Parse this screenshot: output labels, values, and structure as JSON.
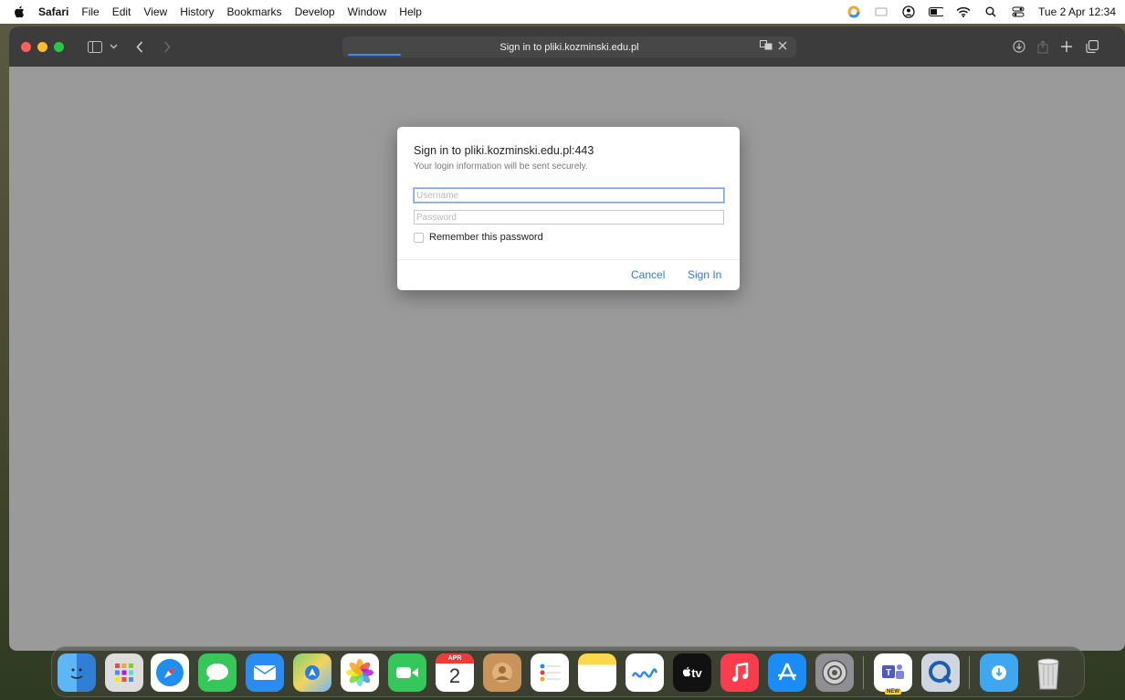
{
  "menubar": {
    "app_name": "Safari",
    "items": [
      "File",
      "Edit",
      "View",
      "History",
      "Bookmarks",
      "Develop",
      "Window",
      "Help"
    ],
    "clock": "Tue 2 Apr  12:34"
  },
  "browser": {
    "address_text": "Sign in to pliki.kozminski.edu.pl",
    "address_right_icons": [
      "translate-icon",
      "close-icon"
    ],
    "toolbar_right_icons": [
      "download-icon",
      "share-icon",
      "new-tab-icon",
      "tab-overview-icon"
    ]
  },
  "dialog": {
    "title": "Sign in to pliki.kozminski.edu.pl:443",
    "subtitle": "Your login information will be sent securely.",
    "username_placeholder": "Username",
    "password_placeholder": "Password",
    "remember_label": "Remember this password",
    "cancel_label": "Cancel",
    "signin_label": "Sign In"
  },
  "dock": {
    "items": [
      "Finder",
      "Launchpad",
      "Safari",
      "Messages",
      "Mail",
      "Maps",
      "Photos",
      "FaceTime",
      "Calendar",
      "Contacts",
      "Reminders",
      "Notes",
      "Freeform",
      "TV",
      "Music",
      "App Store",
      "System Settings",
      "Microsoft Teams",
      "QuickTime Player",
      "Downloads",
      "Trash"
    ],
    "calendar_month": "APR",
    "calendar_day": "2",
    "tv_label": "tv",
    "teams_badge": "NEW"
  },
  "colors": {
    "accent": "#2f7bd9",
    "window_bg": "#9a9a9a",
    "toolbar_bg": "#3c3c3c"
  }
}
